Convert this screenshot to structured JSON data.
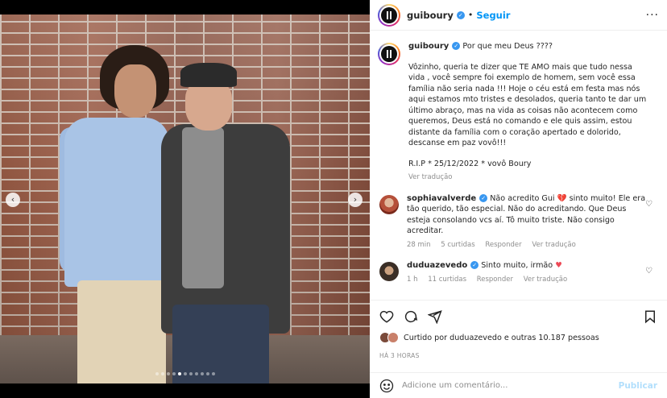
{
  "post": {
    "username": "guiboury",
    "follow_label": "Seguir",
    "more_label": "···",
    "caption": {
      "username": "guiboury",
      "headline": "Por que meu Deus ????",
      "text": "Vôzinho, queria te dizer que TE AMO mais que tudo nessa vida , você sempre foi exemplo de homem, sem você essa família não seria nada !!! Hoje o céu está em festa mas nós aqui estamos mto tristes e desolados, queria tanto te dar um último abraço, mas na vida as coisas não acontecem como queremos, Deus está no comando e ele quis assim, estou distante da família com o coração apertado e dolorido, descanse em paz vovô!!!",
      "rip": "R.I.P * 25/12/2022 * vovô Boury",
      "translate_label": "Ver tradução"
    },
    "comments": [
      {
        "username": "sophiavalverde",
        "text_a": "Não acredito Gui ",
        "emoji": "💔",
        "text_b": " sinto muito! Ele era tão querido, tão especial. Não do acreditando. Que Deus esteja consolando vcs aí. Tô muito triste. Não consigo acreditar.",
        "time": "28 min",
        "likes": "5 curtidas",
        "reply": "Responder",
        "translate": "Ver tradução"
      },
      {
        "username": "duduazevedo",
        "text_a": "Sinto muito, irmão ",
        "emoji": "♥",
        "text_b": "",
        "time": "1 h",
        "likes": "11 curtidas",
        "reply": "Responder",
        "translate": "Ver tradução"
      }
    ],
    "liked_by": "Curtido por duduazevedo e outras 10.187 pessoas",
    "time_ago": "HÁ 3 HORAS",
    "comment_placeholder": "Adicione um comentário...",
    "post_button": "Publicar"
  },
  "carousel": {
    "prev": "‹",
    "next": "›",
    "dots_total": 11,
    "dots_active_index": 4
  },
  "icons": {
    "like": "heart-icon",
    "comment": "comment-icon",
    "share": "share-icon",
    "save": "bookmark-icon",
    "emoji": "emoji-icon"
  },
  "colors": {
    "accent": "#0095f6",
    "verified": "#3897f0",
    "heart_red": "#ed4956"
  }
}
